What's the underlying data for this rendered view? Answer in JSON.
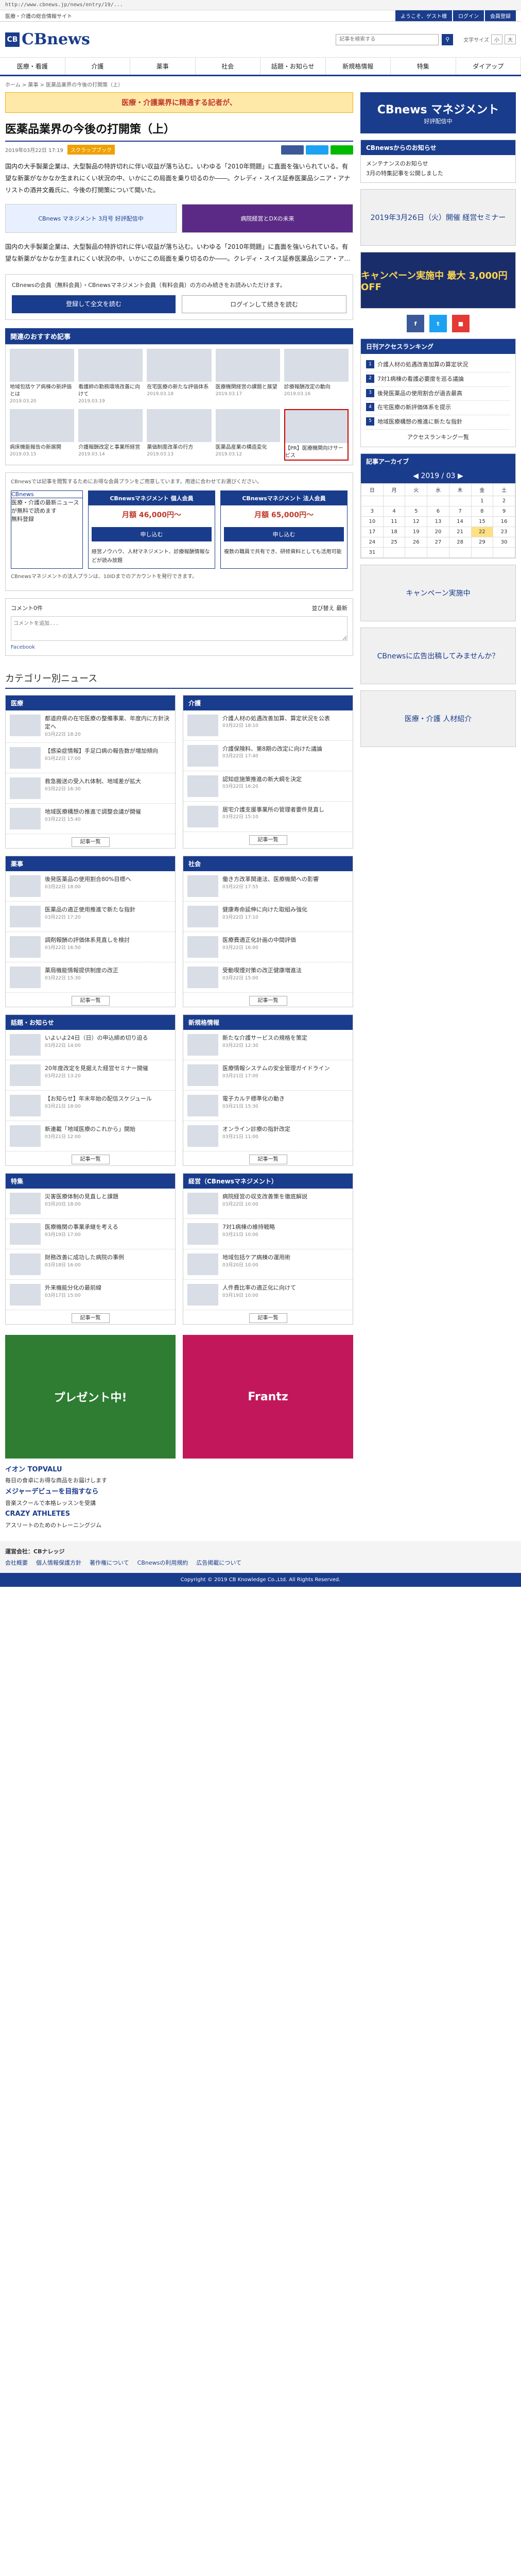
{
  "url": "http://www.cbnews.jp/news/entry/19/...",
  "topbar": {
    "tagline": "医療・介護の総合情報サイト",
    "links": [
      "ようこそ、ゲスト様",
      "ログイン",
      "会員登録"
    ]
  },
  "header": {
    "logo_mark": "CB",
    "logo_text": "CBnews",
    "search_placeholder": "記事を検索する",
    "font_label": "文字サイズ",
    "font_small": "小",
    "font_large": "大"
  },
  "nav": [
    "医療・看護",
    "介護",
    "薬事",
    "社会",
    "話題・お知らせ",
    "新規格情報",
    "特集",
    "ダイアップ"
  ],
  "breadcrumb": "ホーム > 薬事 > 医薬品業界の今後の打開策（上）",
  "main": {
    "banner": "医療・介護業界に精通する記者が、",
    "title": "医薬品業界の今後の打開策（上）",
    "date": "2019年03月22日 17:19",
    "badge": "スクラップブック",
    "body1": "国内の大手製薬企業は、大型製品の特許切れに伴い収益が落ち込む。いわゆる「2010年問題」に直面を強いられている。有望な新薬がなかなか生まれにくい状況の中、いかにこの局面を乗り切るのか――。クレディ・スイス証券医薬品シニア・アナリストの酒井文義氏に、今後の打開策について聞いた。",
    "ad1": "CBnews マネジメント 3月号 好評配信中",
    "ad2": "病院経営とDXの未来",
    "body2": "国内の大手製薬企業は、大型製品の特許切れに伴い収益が落ち込む。いわゆる「2010年問題」に直面を強いられている。有望な新薬がなかなか生まれにくい状況の中、いかにこの局面を乗り切るのか――。クレディ・スイス証券医薬品シニア・ア…",
    "member_text": "CBnewsの会員（無料会員）・CBnewsマネジメント会員（有料会員）の方のみ続きをお読みいただけます。",
    "register_btn": "登録して全文を読む",
    "login_btn": "ログインして続きを読む"
  },
  "recommend": {
    "title": "関連のおすすめ記事",
    "items": [
      {
        "text": "地域包括ケア病棟の新評価とは",
        "date": "2019.03.20"
      },
      {
        "text": "看護師の勤務環境改善に向けて",
        "date": "2019.03.19"
      },
      {
        "text": "在宅医療の新たな評価体系",
        "date": "2019.03.18"
      },
      {
        "text": "医療機関経営の課題と展望",
        "date": "2019.03.17"
      },
      {
        "text": "診療報酬改定の動向",
        "date": "2019.03.16"
      },
      {
        "text": "病床機能報告の新展開",
        "date": "2019.03.15"
      },
      {
        "text": "介護報酬改定と事業所経営",
        "date": "2019.03.14"
      },
      {
        "text": "薬価制度改革の行方",
        "date": "2019.03.13"
      },
      {
        "text": "医薬品産業の構造変化",
        "date": "2019.03.12"
      },
      {
        "text": "【PR】医療機関向けサービス",
        "date": ""
      }
    ]
  },
  "plans": {
    "note": "CBnewsでは記事を閲覧するためにお得な会員プランをご用意しています。用途に合わせてお選びください。",
    "first": {
      "title": "CBnews",
      "desc": "医療・介護の最新ニュースが無料で読めます",
      "btn": "無料登録"
    },
    "cols": [
      {
        "title": "CBnewsマネジメント 個人会員",
        "price": "月額 46,000円〜",
        "btn": "申し込む",
        "detail": "経営ノウハウ、人材マネジメント、診療報酬情報などが読み放題"
      },
      {
        "title": "CBnewsマネジメント 法人会員",
        "price": "月額 65,000円〜",
        "btn": "申し込む",
        "detail": "複数の職員で共有でき、研修資料としても活用可能"
      }
    ],
    "footer_note": "CBnewsマネジメントの法人プランは、10IDまでのアカウントを発行できます。"
  },
  "facebook": {
    "label": "Facebook",
    "count_label": "コメント0件",
    "sort_label": "並び替え 最新",
    "placeholder": "コメントを追加..."
  },
  "categories": {
    "title": "カテゴリー別ニュース",
    "boxes": [
      {
        "name": "医療",
        "items": [
          {
            "text": "都道府県の在宅医療の整備事業、年度内に方針決定へ",
            "date": "03月22日 18:20"
          },
          {
            "text": "【感染症情報】手足口病の報告数が増加傾向",
            "date": "03月22日 17:00"
          },
          {
            "text": "救急搬送の受入れ体制、地域差が拡大",
            "date": "03月22日 16:30"
          },
          {
            "text": "地域医療構想の推進で調整会議が開催",
            "date": "03月22日 15:40"
          }
        ],
        "more": "記事一覧"
      },
      {
        "name": "介護",
        "items": [
          {
            "text": "介護人材の処遇改善加算、算定状況を公表",
            "date": "03月22日 18:10"
          },
          {
            "text": "介護保険料、第8期の改定に向けた議論",
            "date": "03月22日 17:40"
          },
          {
            "text": "認知症施策推進の新大綱を決定",
            "date": "03月22日 16:20"
          },
          {
            "text": "居宅介護支援事業所の管理者要件見直し",
            "date": "03月22日 15:10"
          }
        ],
        "more": "記事一覧"
      },
      {
        "name": "薬事",
        "items": [
          {
            "text": "後発医薬品の使用割合80%目標へ",
            "date": "03月22日 18:00"
          },
          {
            "text": "医薬品の適正使用推進で新たな指針",
            "date": "03月22日 17:20"
          },
          {
            "text": "調剤報酬の評価体系見直しを検討",
            "date": "03月22日 16:50"
          },
          {
            "text": "薬局機能情報提供制度の改正",
            "date": "03月22日 15:30"
          }
        ],
        "more": "記事一覧"
      },
      {
        "name": "社会",
        "items": [
          {
            "text": "働き方改革関連法、医療機関への影響",
            "date": "03月22日 17:55"
          },
          {
            "text": "健康寿命延伸に向けた取組み強化",
            "date": "03月22日 17:10"
          },
          {
            "text": "医療費適正化計画の中間評価",
            "date": "03月22日 16:00"
          },
          {
            "text": "受動喫煙対策の改正健康増進法",
            "date": "03月22日 15:00"
          }
        ],
        "more": "記事一覧"
      },
      {
        "name": "話題・お知らせ",
        "items": [
          {
            "text": "いよいよ24日（日）の申込締め切り迫る",
            "date": "03月22日 14:00"
          },
          {
            "text": "20年度改定を見据えた経営セミナー開催",
            "date": "03月22日 13:20"
          },
          {
            "text": "【お知らせ】年末年始の配信スケジュール",
            "date": "03月21日 18:00"
          },
          {
            "text": "新連載「地域医療のこれから」開始",
            "date": "03月21日 12:00"
          }
        ],
        "more": "記事一覧"
      },
      {
        "name": "新規格情報",
        "items": [
          {
            "text": "新たな介護サービスの規格を策定",
            "date": "03月22日 12:30"
          },
          {
            "text": "医療情報システムの安全管理ガイドライン",
            "date": "03月21日 17:00"
          },
          {
            "text": "電子カルテ標準化の動き",
            "date": "03月21日 15:30"
          },
          {
            "text": "オンライン診療の指針改定",
            "date": "03月21日 11:00"
          }
        ],
        "more": "記事一覧"
      },
      {
        "name": "特集",
        "items": [
          {
            "text": "災害医療体制の見直しと課題",
            "date": "03月20日 18:00"
          },
          {
            "text": "医療機関の事業承継を考える",
            "date": "03月19日 17:00"
          },
          {
            "text": "財務改善に成功した病院の事例",
            "date": "03月18日 16:00"
          },
          {
            "text": "外来機能分化の最前線",
            "date": "03月17日 15:00"
          }
        ],
        "more": "記事一覧"
      },
      {
        "name": "経営（CBnewsマネジメント）",
        "items": [
          {
            "text": "病院経営の収支改善策を徹底解説",
            "date": "03月22日 10:00"
          },
          {
            "text": "7対1病棟の維持戦略",
            "date": "03月21日 10:00"
          },
          {
            "text": "地域包括ケア病棟の運用術",
            "date": "03月20日 10:00"
          },
          {
            "text": "人件費比率の適正化に向けて",
            "date": "03月19日 10:00"
          }
        ],
        "more": "記事一覧"
      }
    ]
  },
  "promos": {
    "left": "プレゼント中!",
    "right": "Frantz"
  },
  "ad_links": [
    {
      "title": "イオン TOPVALU",
      "desc": "毎日の食卓にお得な商品をお届けします"
    },
    {
      "title": "メジャーデビューを目指すなら",
      "desc": "音楽スクールで本格レッスンを受講"
    },
    {
      "title": "CRAZY ATHLETES",
      "desc": "アスリートのためのトレーニングジム"
    }
  ],
  "side": {
    "banner_title": "CBnews マネジメント",
    "banner_sub": "好評配信中",
    "notice_title": "CBnewsからのお知らせ",
    "notices": [
      "メンテナンスのお知らせ",
      "3月の特集記事を公開しました"
    ],
    "seminar": "2019年3月26日（火）開催 経営セミナー",
    "campaign": "キャンペーン実施中 最大 3,000円 OFF",
    "ranking_title": "日刊アクセスランキング",
    "ranking": [
      "介護人材の処遇改善加算の算定状況",
      "7対1病棟の看護必要度を巡る議論",
      "後発医薬品の使用割合が過去最高",
      "在宅医療の新評価体系を提示",
      "地域医療構想の推進に新たな指針"
    ],
    "ranking_more": "アクセスランキング一覧",
    "calendar_title": "記事アーカイブ",
    "calendar_month": "2019 / 03",
    "weekdays": [
      "日",
      "月",
      "火",
      "水",
      "木",
      "金",
      "土"
    ],
    "ad1": "キャンペーン実施中",
    "ad2": "CBnewsに広告出稿してみませんか？",
    "ad3": "医療・介護 人材紹介"
  },
  "footer": {
    "company": "運営会社：CBナレッジ",
    "links": [
      "会社概要",
      "個人情報保護方針",
      "著作権について",
      "CBnewsの利用規約",
      "広告掲載について"
    ],
    "copyright": "Copyright © 2019 CB Knowledge Co.,Ltd. All Rights Reserved."
  }
}
